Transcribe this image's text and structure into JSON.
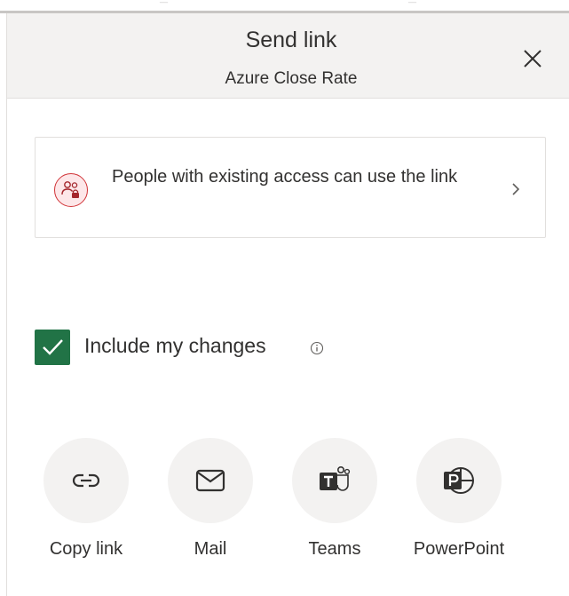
{
  "dialog": {
    "title": "Send link",
    "subtitle": "Azure Close Rate"
  },
  "access": {
    "text": "People with existing access can use the link"
  },
  "include_changes": {
    "label": "Include my changes",
    "checked": true
  },
  "share_options": [
    {
      "label": "Copy link",
      "icon": "link-icon"
    },
    {
      "label": "Mail",
      "icon": "mail-icon"
    },
    {
      "label": "Teams",
      "icon": "teams-icon"
    },
    {
      "label": "PowerPoint",
      "icon": "powerpoint-icon"
    }
  ],
  "colors": {
    "header_bg": "#f3f2f1",
    "checkbox_accent": "#217346",
    "access_icon_bg": "#fde7e9",
    "access_icon_accent": "#d13438",
    "text": "#323130"
  }
}
